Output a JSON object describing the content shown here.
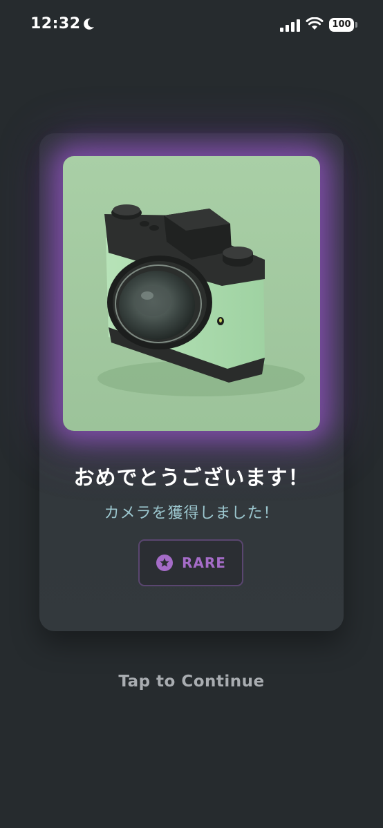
{
  "status_bar": {
    "time": "12:32",
    "battery": "100",
    "icons": [
      "moon-icon",
      "signal-icon",
      "wifi-icon",
      "battery-icon"
    ]
  },
  "reward": {
    "image_icon": "camera-icon",
    "title": "おめでとうございます！",
    "subtitle": "カメラを獲得しました！",
    "rarity_icon": "star-icon",
    "rarity": "RARE"
  },
  "continue_label": "Tap to Continue",
  "colors": {
    "background": "#262b2e",
    "card": "#32383c",
    "glow": "#a85cdc",
    "subtitle": "#9cc7cf",
    "rarity": "#a56cc8",
    "continue": "#a9adb1"
  }
}
